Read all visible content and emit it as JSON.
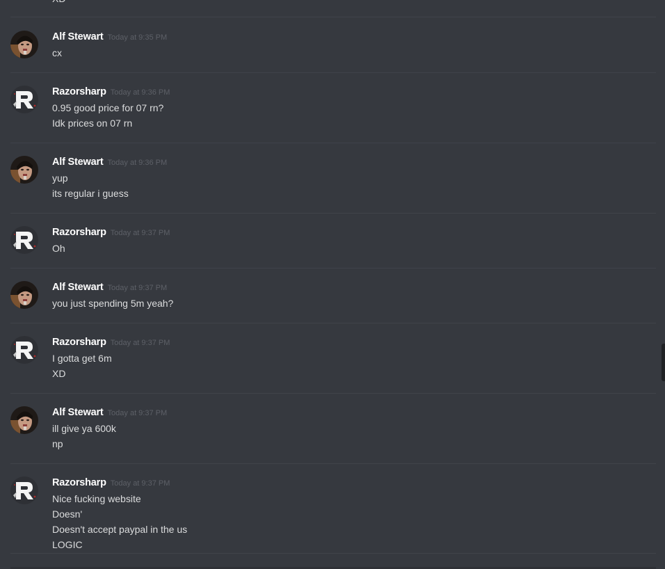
{
  "top_fragment": "XD",
  "messages": [
    {
      "author": "Alf Stewart",
      "avatar": "alf-avatar",
      "time": "Today at 9:35 PM",
      "lines": [
        "cx"
      ]
    },
    {
      "author": "Razorsharp",
      "avatar": "razorsharp-avatar",
      "time": "Today at 9:36 PM",
      "lines": [
        "0.95 good price for 07 rn?",
        "Idk prices on 07 rn"
      ]
    },
    {
      "author": "Alf Stewart",
      "avatar": "alf-avatar",
      "time": "Today at 9:36 PM",
      "lines": [
        "yup",
        "its regular i guess"
      ]
    },
    {
      "author": "Razorsharp",
      "avatar": "razorsharp-avatar",
      "time": "Today at 9:37 PM",
      "lines": [
        "Oh"
      ]
    },
    {
      "author": "Alf Stewart",
      "avatar": "alf-avatar",
      "time": "Today at 9:37 PM",
      "lines": [
        "you just spending 5m yeah?"
      ]
    },
    {
      "author": "Razorsharp",
      "avatar": "razorsharp-avatar",
      "time": "Today at 9:37 PM",
      "lines": [
        "I gotta get 6m",
        "XD"
      ]
    },
    {
      "author": "Alf Stewart",
      "avatar": "alf-avatar",
      "time": "Today at 9:37 PM",
      "lines": [
        "ill give ya 600k",
        "np"
      ]
    },
    {
      "author": "Razorsharp",
      "avatar": "razorsharp-avatar",
      "time": "Today at 9:37 PM",
      "lines": [
        "Nice fucking website",
        "Doesn'",
        "Doesn't accept paypal in the us",
        "LOGIC"
      ]
    }
  ],
  "colors": {
    "background": "#36393f",
    "username": "#ffffff",
    "message_text": "#dcddde",
    "timestamp": "#5d6067",
    "divider": "#40434a"
  }
}
